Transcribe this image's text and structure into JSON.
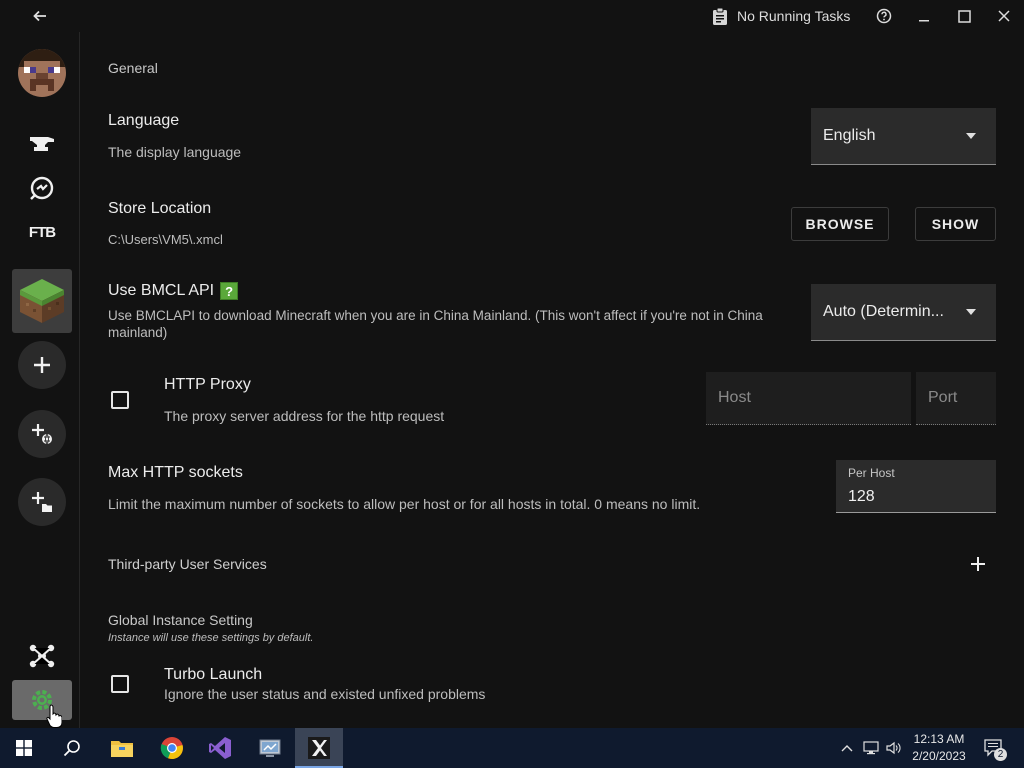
{
  "titlebar": {
    "tasks_label": "No Running Tasks"
  },
  "sidebar": {
    "items": [
      {
        "icon": "anvil-icon"
      },
      {
        "icon": "curseforge-refresh-icon"
      },
      {
        "icon": "ftb-icon",
        "label": "FTB"
      },
      {
        "icon": "grass-block-icon"
      },
      {
        "icon": "plus-icon"
      },
      {
        "icon": "add-from-web-icon"
      },
      {
        "icon": "add-from-folder-icon"
      },
      {
        "icon": "multiplayer-network-icon"
      },
      {
        "icon": "settings-gear-icon"
      }
    ]
  },
  "general": {
    "section_label": "General",
    "language": {
      "title": "Language",
      "subtitle": "The display language",
      "value": "English"
    },
    "store_location": {
      "title": "Store Location",
      "path": "C:\\Users\\VM5\\.xmcl",
      "browse_label": "BROWSE",
      "show_label": "SHOW"
    },
    "bmcl": {
      "title": "Use BMCL API",
      "help_glyph": "?",
      "subtitle": "Use BMCLAPI to download Minecraft when you are in China Mainland. (This won't affect if you're not in China mainland)",
      "value": "Auto (Determin..."
    },
    "http_proxy": {
      "title": "HTTP Proxy",
      "subtitle": "The proxy server address for the http request",
      "host_placeholder": "Host",
      "port_placeholder": "Port",
      "checked": false
    },
    "max_sockets": {
      "title": "Max HTTP sockets",
      "subtitle": "Limit the maximum number of sockets to allow per host or for all hosts in total. 0 means no limit.",
      "field_label": "Per Host",
      "field_value": "128"
    },
    "third_party": {
      "title": "Third-party User Services"
    }
  },
  "global_instance": {
    "section_label": "Global Instance Setting",
    "section_sub": "Instance will use these settings by default.",
    "turbo_launch": {
      "title": "Turbo Launch",
      "subtitle": "Ignore the user status and existed unfixed problems",
      "checked": false
    }
  },
  "taskbar": {
    "apps": [
      "windows-start-icon",
      "search-icon",
      "file-explorer-icon",
      "chrome-icon",
      "visual-studio-icon",
      "control-panel-icon",
      "xmcl-app-icon"
    ],
    "time": "12:13 AM",
    "date": "2/20/2023",
    "notification_count": "2"
  },
  "colors": {
    "background": "#121212",
    "accent_green": "#5aa83a",
    "taskbar": "#0f1a2e"
  }
}
